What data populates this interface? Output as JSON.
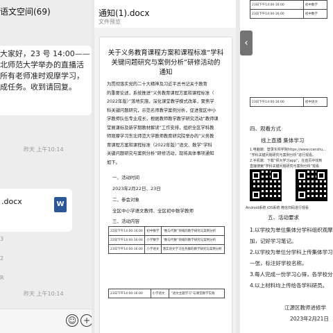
{
  "left": {
    "title": "语文空间(69)",
    "message_lines": [
      "大家好，23 号 14:00——",
      "北师范大学举办的直播活",
      "所有老师准时观摩学习，",
      "成任务。收到请回复。"
    ],
    "time1": "昨天 上午10:14",
    "file_name": ".docx",
    "file_icon": "W",
    "time2": "昨天 上午10:14",
    "stubs": [
      "3",
      "2",
      "R"
    ],
    "emoji_icon": "☺",
    "plus_icon": "+"
  },
  "doc": {
    "tab_title": "通知(1).docx",
    "subtitle": "文件预览",
    "heading": [
      "关于义务教育课程方案和课程标准“学科",
      "关键问题研究与案例分析”研修活动的",
      "通知"
    ],
    "body": [
      "为贯彻落实党的二十大精神及习近平总书记关于教育",
      "的重要论述，系统推进“义务教育课程方案和课程标准（",
      "2022年版）”落地实施，深化课堂教学模式改革，聚焦学",
      "科关键问题研究，示范名师教学案例分析，促进我区中小",
      "学教师队伍专业成长，根据教师教学教学研究活动“教师课",
      "堂展课标及新学期教材解读”工作安排，组织全区学科教",
      "师观摩学习东北师范大学教师教育研究院举办的“义务教",
      "育课程方案和课程标准（2022年版）”语文、数学“学科",
      "关键问题研究与案例分析”研修活动，现将具体事项通知",
      "如下。"
    ],
    "section1": "一、活动时间",
    "date": "2023年2月22日、23日",
    "section2": "二、参会对象",
    "audience": "全区中小学语文教师、全区初中数学教师",
    "section3": "三、活动内容",
    "table": [
      [
        "22日下午14:00-16:00",
        "初中数学",
        "“数与代数”领域的教学研究与案例分析"
      ],
      [
        "22日下午14:00-16:00",
        "小学数学",
        "“数与代数”领域的教学研究与案例分析"
      ],
      [
        "23日下午14:00-16:00",
        "小学语文",
        "落实语文学习任务群的教学研究与案例分析"
      ]
    ],
    "table2": [
      [
        "23日下午14:00-16:00",
        "小学语文",
        "“语文主题学习”与课堂教学实践"
      ]
    ]
  },
  "right": {
    "top_rows": [
      [
        "23日下午14:00-16:00",
        "初中数学"
      ],
      [
        "23日下午14:00-16:00",
        "初中数学"
      ]
    ],
    "mid_row": [
      "23日下午14:00-16:00",
      "初中语文"
    ],
    "section4": "四、观看方式",
    "online": "线上直播  集体学习",
    "small": [
      "1.电脑端：登录东师学院https://www.icanshu...",
      "“学科关键问题研究与案例分析”进行观看。",
      "2.手机端：下载“师大学习app”，在首页中找到",
      "直接搜索“学科关键问题研究与案例分析”观看"
    ],
    "qr_caption": "Android系统  iOS系统  微信扫码进行观看",
    "section5": "五、活动要求",
    "reqs": [
      "1.以学校为单位集体分学科组织观摩",
      "加，记好学习笔记。",
      "2.以学校为单位分学科上传集体学习照",
      "一张，标注好学校名称。",
      "3.每人完成一份学习心得，各学校分学",
      "4.以上材料均上传给各学科研员。"
    ],
    "org": "江源区教师进修学",
    "sign_date": "2023年2月21日"
  }
}
